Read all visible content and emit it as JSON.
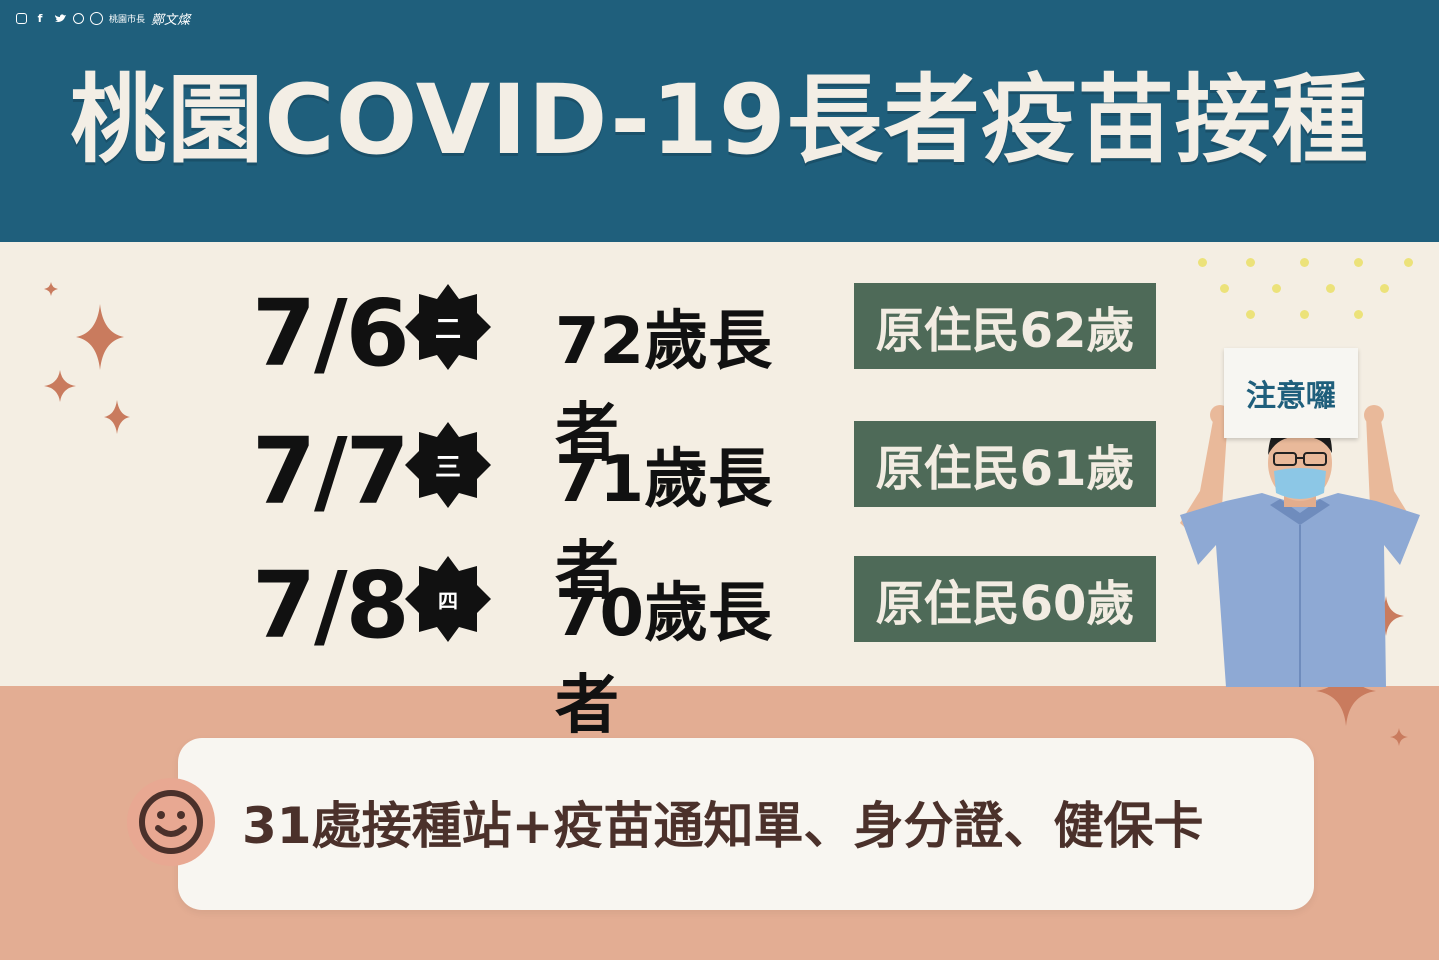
{
  "header": {
    "social_icons": [
      "instagram-icon",
      "facebook-icon",
      "twitter-icon",
      "whatsapp-icon",
      "seal-icon"
    ],
    "office_label": "桃園市長",
    "signature": "鄭文燦",
    "title": "桃園COVID-19長者疫苗接種"
  },
  "schedule": [
    {
      "date": "7/6",
      "weekday": "二",
      "age_label": "72歲長者",
      "indigenous_label": "原住民62歲"
    },
    {
      "date": "7/7",
      "weekday": "三",
      "age_label": "71歲長者",
      "indigenous_label": "原住民61歲"
    },
    {
      "date": "7/8",
      "weekday": "四",
      "age_label": "70歲長者",
      "indigenous_label": "原住民60歲"
    }
  ],
  "sign": {
    "text": "注意囉"
  },
  "footer": {
    "icon": "smile-icon",
    "text": "31處接種站+疫苗通知單、身分證、健保卡"
  },
  "colors": {
    "header_bg": "#1f5f7c",
    "middle_bg": "#f4eee3",
    "bottom_bg": "#e3ad93",
    "tag_bg": "#4e6a58",
    "accent_star": "#c97b5e",
    "dot": "#ece27a"
  }
}
